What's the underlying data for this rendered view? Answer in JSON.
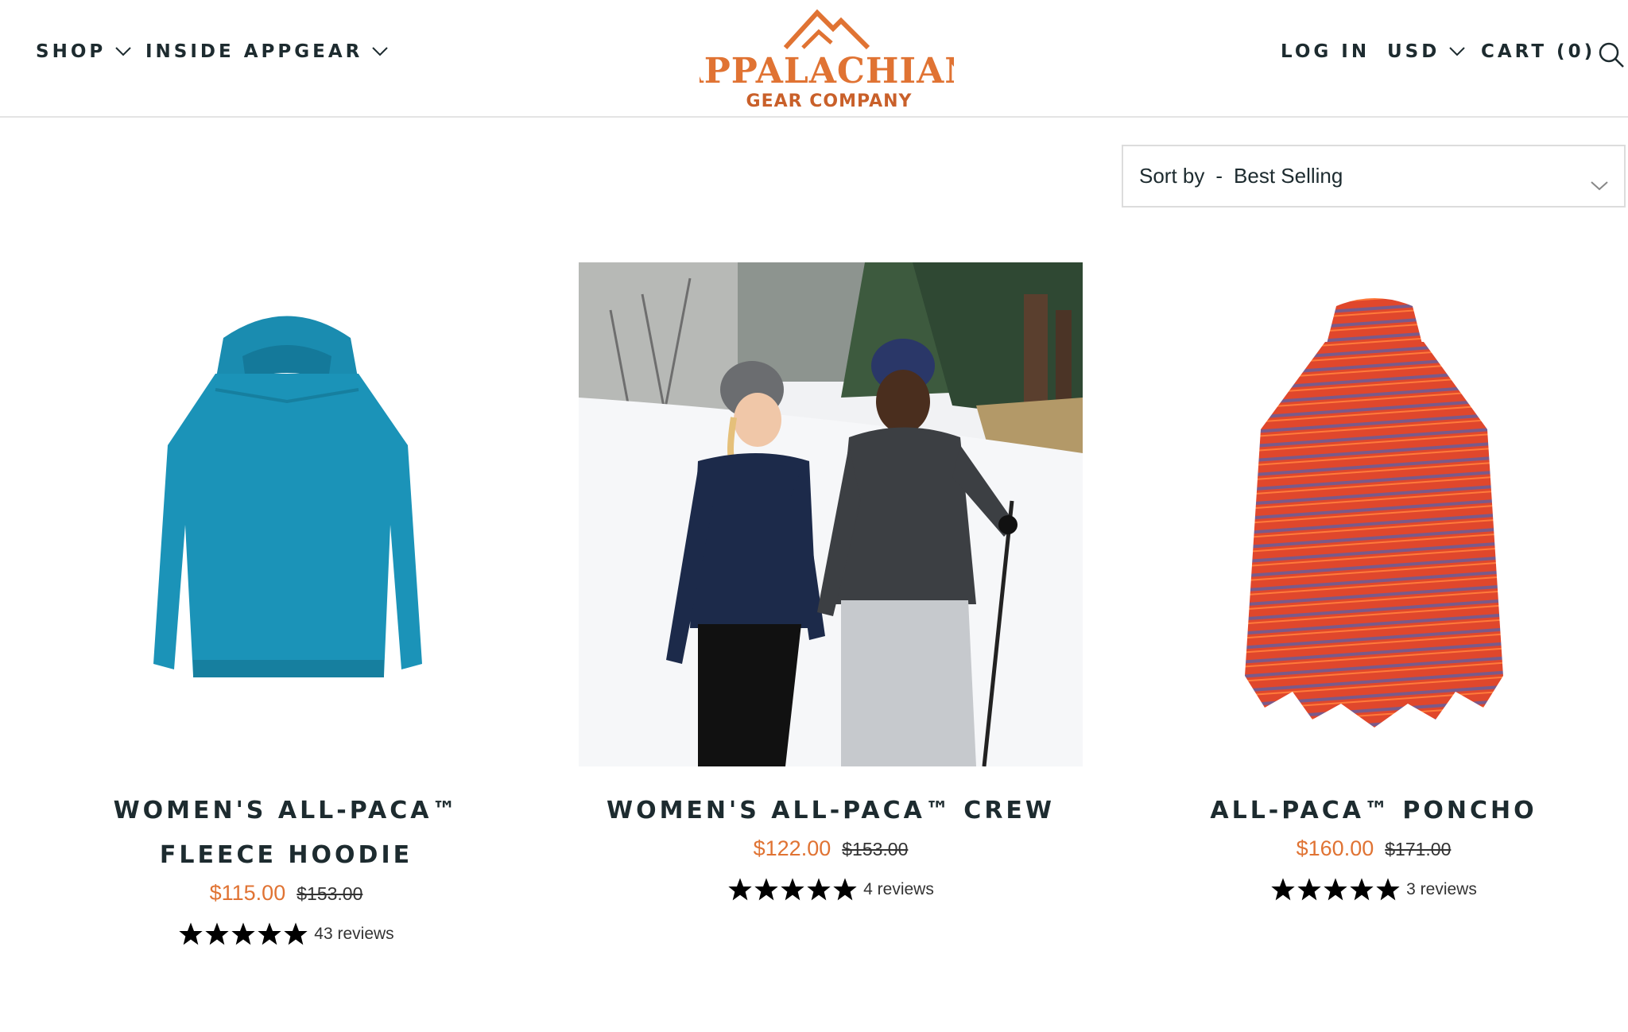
{
  "header": {
    "nav": [
      {
        "label": "SHOP"
      },
      {
        "label": "INSIDE APPGEAR"
      }
    ],
    "logo": {
      "line1": "APPALACHIAN",
      "line2": "GEAR COMPANY"
    },
    "login_label": "LOG IN",
    "currency_label": "USD",
    "cart_label": "CART (0)"
  },
  "sort": {
    "prefix": "Sort by",
    "separator": "-",
    "value": "Best Selling"
  },
  "products": [
    {
      "title": "WOMEN'S ALL-PACA™ FLEECE HOODIE",
      "price": "$115.00",
      "compare_price": "$153.00",
      "rating": 5,
      "reviews": "43 reviews",
      "image_icon": "teal-hoodie-image",
      "color": "#1b93b8"
    },
    {
      "title": "WOMEN'S ALL-PACA™ CREW",
      "price": "$122.00",
      "compare_price": "$153.00",
      "rating": 5,
      "reviews": "4 reviews",
      "image_icon": "couple-hiking-snow-photo",
      "color": "#1c2a4a"
    },
    {
      "title": "ALL-PACA™ PONCHO",
      "price": "$160.00",
      "compare_price": "$171.00",
      "rating": 5,
      "reviews": "3 reviews",
      "image_icon": "striped-poncho-image",
      "color": "#e0472c"
    }
  ],
  "colors": {
    "accent": "#e07333",
    "text": "#1d2b2f",
    "border": "#dcdcdc"
  }
}
